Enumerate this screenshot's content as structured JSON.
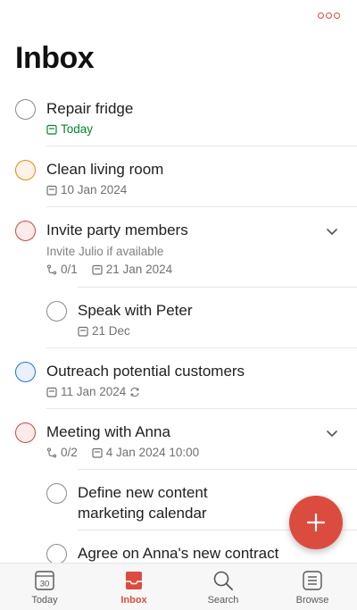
{
  "header": {
    "title": "Inbox",
    "more_icon": "more-horizontal-icon"
  },
  "colors": {
    "accent": "#dc4c3e",
    "priority1": "#d1453b",
    "priority2": "#eb8909",
    "priority3": "#246fe0",
    "today_green": "#058527"
  },
  "tasks": [
    {
      "title": "Repair fridge",
      "due": "Today",
      "priority": "none"
    },
    {
      "title": "Clean living room",
      "due": "10 Jan 2024",
      "priority": "p2"
    },
    {
      "title": "Invite party members",
      "description": "Invite Julio if available",
      "subtasks": "0/1",
      "due": "21 Jan 2024",
      "priority": "p1",
      "expanded": true
    },
    {
      "title": "Speak with Peter",
      "due": "21 Dec",
      "priority": "none",
      "subtask": true
    },
    {
      "title": "Outreach potential customers",
      "due": "11 Jan 2024",
      "recurring": true,
      "priority": "p3"
    },
    {
      "title": "Meeting with Anna",
      "subtasks": "0/2",
      "due": "4 Jan 2024 10:00",
      "priority": "p1",
      "expanded": true
    },
    {
      "title_line1": "Define new content",
      "title_line2": "marketing calendar",
      "priority": "none",
      "subtask": true
    },
    {
      "title": "Agree on Anna's new contract",
      "priority": "none",
      "subtask": true
    }
  ],
  "fab": {
    "icon": "plus-icon"
  },
  "tabbar": {
    "tabs": [
      {
        "label": "Today",
        "icon": "calendar-30-icon",
        "icon_text": "30"
      },
      {
        "label": "Inbox",
        "icon": "inbox-icon",
        "active": true
      },
      {
        "label": "Search",
        "icon": "search-icon"
      },
      {
        "label": "Browse",
        "icon": "browse-list-icon"
      }
    ]
  }
}
